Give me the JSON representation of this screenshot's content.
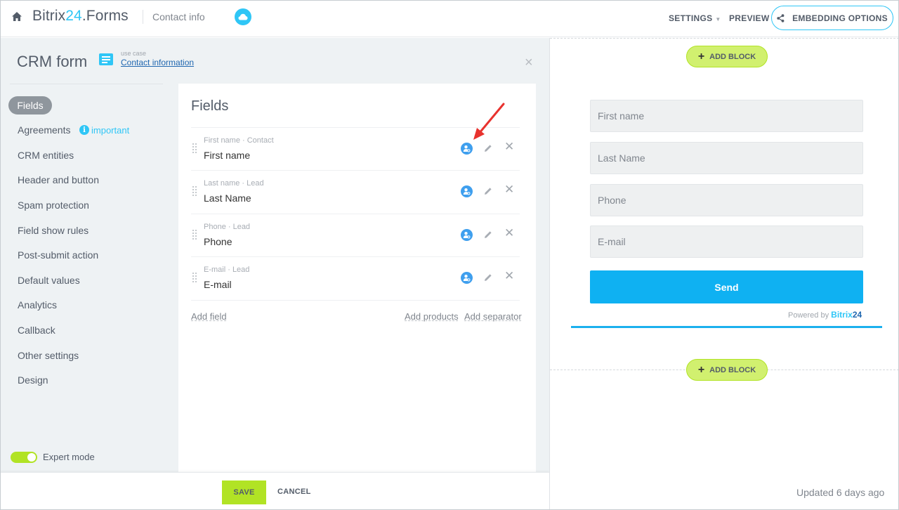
{
  "topbar": {
    "brand_prefix": "Bitrix",
    "brand_number": "24",
    "brand_suffix": ".Forms",
    "form_name": "Contact info",
    "settings_label": "SETTINGS",
    "preview_label": "PREVIEW",
    "embed_label": "EMBEDDING OPTIONS"
  },
  "panel": {
    "title": "CRM form",
    "usecase_caption": "use case",
    "usecase_link": "Contact information",
    "nav": [
      {
        "label": "Fields"
      },
      {
        "label": "Agreements"
      },
      {
        "label": "CRM entities"
      },
      {
        "label": "Header and button"
      },
      {
        "label": "Spam protection"
      },
      {
        "label": "Field show rules"
      },
      {
        "label": "Post-submit action"
      },
      {
        "label": "Default values"
      },
      {
        "label": "Analytics"
      },
      {
        "label": "Callback"
      },
      {
        "label": "Other settings"
      },
      {
        "label": "Design"
      }
    ],
    "important_label": "important",
    "expert_mode_label": "Expert mode"
  },
  "fields_card": {
    "title": "Fields",
    "rows": [
      {
        "meta": "First name · Contact",
        "name": "First name"
      },
      {
        "meta": "Last name · Lead",
        "name": "Last Name"
      },
      {
        "meta": "Phone · Lead",
        "name": "Phone"
      },
      {
        "meta": "E-mail · Lead",
        "name": "E-mail"
      }
    ],
    "add_field": "Add field",
    "add_products": "Add products",
    "add_separator": "Add separator"
  },
  "footer": {
    "save_label": "SAVE",
    "cancel_label": "CANCEL"
  },
  "preview": {
    "add_block_label": "ADD BLOCK",
    "inputs": [
      {
        "placeholder": "First name"
      },
      {
        "placeholder": "Last Name"
      },
      {
        "placeholder": "Phone"
      },
      {
        "placeholder": "E-mail"
      }
    ],
    "send_label": "Send",
    "powered_by": "Powered by",
    "powered_brand": "Bitrix",
    "powered_brand_num": "24",
    "updated": "Updated 6 days ago"
  },
  "colors": {
    "accent": "#2fc6f6",
    "green": "#b1e325",
    "send": "#0fb1f2",
    "annotation": "#e8322e"
  }
}
